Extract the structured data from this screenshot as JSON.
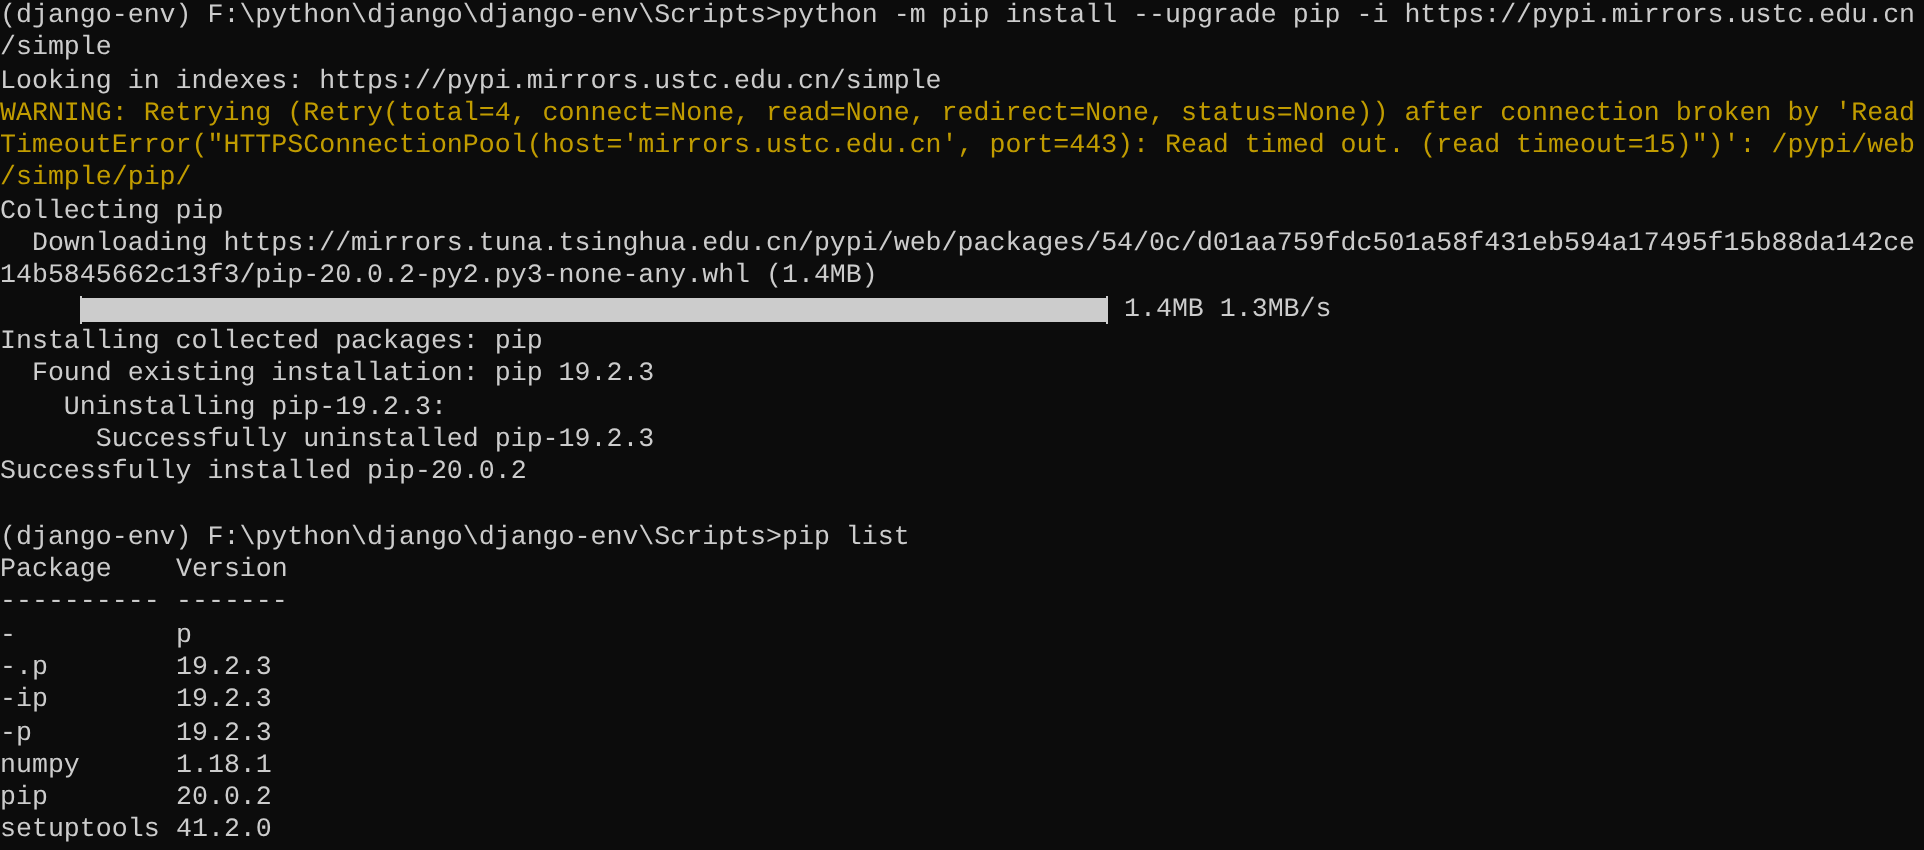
{
  "terminal": {
    "lines": [
      {
        "kind": "text",
        "text": "(django-env) F:\\python\\django\\django-env\\Scripts>python -m pip install --upgrade pip -i https://pypi.mirrors.ustc.edu.cn"
      },
      {
        "kind": "text",
        "text": "/simple"
      },
      {
        "kind": "text",
        "text": "Looking in indexes: https://pypi.mirrors.ustc.edu.cn/simple"
      },
      {
        "kind": "warning",
        "text": "WARNING: Retrying (Retry(total=4, connect=None, read=None, redirect=None, status=None)) after connection broken by 'Read"
      },
      {
        "kind": "warning",
        "text": "TimeoutError(\"HTTPSConnectionPool(host='mirrors.ustc.edu.cn', port=443): Read timed out. (read timeout=15)\")': /pypi/web"
      },
      {
        "kind": "warning",
        "text": "/simple/pip/"
      },
      {
        "kind": "text",
        "text": "Collecting pip"
      },
      {
        "kind": "text",
        "text": "  Downloading https://mirrors.tuna.tsinghua.edu.cn/pypi/web/packages/54/0c/d01aa759fdc501a58f431eb594a17495f15b88da142ce"
      },
      {
        "kind": "text",
        "text": "14b5845662c13f3/pip-20.0.2-py2.py3-none-any.whl (1.4MB)"
      },
      {
        "kind": "progress",
        "level": 1,
        "reading": "1.4MB 1.3MB/s"
      },
      {
        "kind": "text",
        "text": "Installing collected packages: pip"
      },
      {
        "kind": "text",
        "text": "  Found existing installation: pip 19.2.3"
      },
      {
        "kind": "text",
        "text": "    Uninstalling pip-19.2.3:"
      },
      {
        "kind": "text",
        "text": "      Successfully uninstalled pip-19.2.3"
      },
      {
        "kind": "text",
        "text": "Successfully installed pip-20.0.2"
      },
      {
        "kind": "blank"
      },
      {
        "kind": "text",
        "text": "(django-env) F:\\python\\django\\django-env\\Scripts>pip list"
      },
      {
        "kind": "table",
        "columns": [
          "Package",
          "Version"
        ],
        "separator": [
          "----------",
          "-------"
        ],
        "rows": [
          {
            "package": "-",
            "version": "p"
          },
          {
            "package": "-.p",
            "version": "19.2.3"
          },
          {
            "package": "-ip",
            "version": "19.2.3"
          },
          {
            "package": "-p",
            "version": "19.2.3"
          },
          {
            "package": "numpy",
            "version": "1.18.1"
          },
          {
            "package": "pip",
            "version": "20.0.2"
          },
          {
            "package": "setuptools",
            "version": "41.2.0"
          }
        ]
      }
    ]
  }
}
